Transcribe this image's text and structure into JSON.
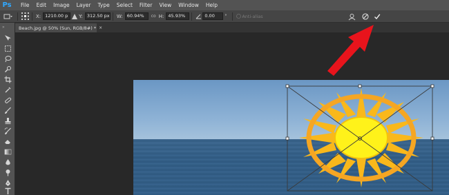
{
  "app": {
    "logo": "Ps"
  },
  "menu": [
    "File",
    "Edit",
    "Image",
    "Layer",
    "Type",
    "Select",
    "Filter",
    "View",
    "Window",
    "Help"
  ],
  "options": {
    "x_label": "X:",
    "x_value": "1210.00 p",
    "y_label": "Y:",
    "y_value": "312.50 px",
    "w_label": "W:",
    "w_value": "60.94%",
    "link_label": "co",
    "h_label": "H:",
    "h_value": "45.93%",
    "angle_value": "0.00",
    "angle_unit": "°",
    "antialias_label": "Anti-alias"
  },
  "tab": {
    "title": "Beach.jpg @ 50% (Sun, RGB/8#) *",
    "close": "×"
  },
  "toolbar": {
    "grip": "»"
  },
  "colors": {
    "accent_arrow": "#e8141c",
    "ps_blue": "#31a8ff",
    "sun_yellow": "#fff21a",
    "sun_orange": "#f5a623"
  },
  "tools": [
    "move-tool",
    "marquee-tool",
    "lasso-tool",
    "quick-select-tool",
    "crop-tool",
    "eyedropper-tool",
    "healing-brush-tool",
    "brush-tool",
    "clone-stamp-tool",
    "history-brush-tool",
    "eraser-tool",
    "gradient-tool",
    "blur-tool",
    "dodge-tool",
    "pen-tool",
    "type-tool"
  ]
}
